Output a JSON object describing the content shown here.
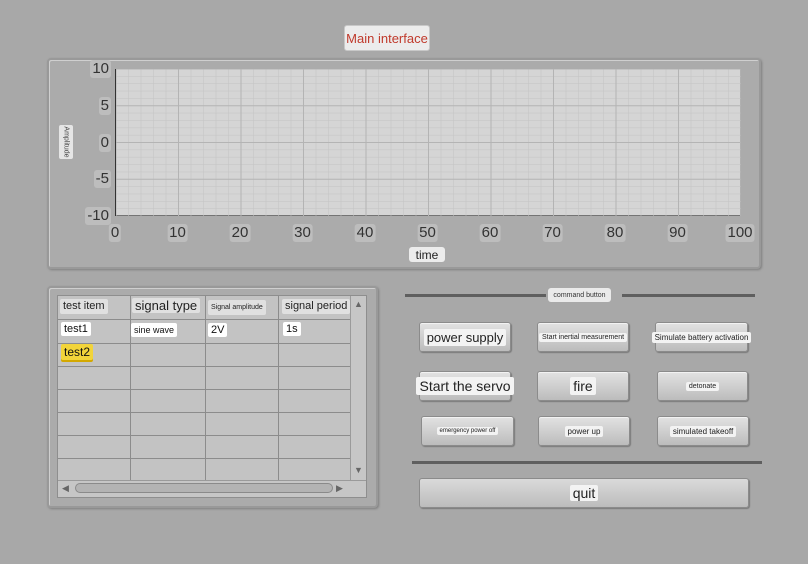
{
  "header": {
    "title": "Main interface"
  },
  "chart_data": {
    "type": "line",
    "title": "",
    "xlabel": "time",
    "ylabel": "Amplitude",
    "xlim": [
      0,
      100
    ],
    "ylim": [
      -10,
      10
    ],
    "x_ticks": [
      "0",
      "10",
      "20",
      "30",
      "40",
      "50",
      "60",
      "70",
      "80",
      "90",
      "100"
    ],
    "y_ticks": [
      "10",
      "5",
      "0",
      "-5",
      "-10"
    ],
    "grid": true,
    "series": []
  },
  "table": {
    "columns": [
      "test item",
      "signal type",
      "Signal amplitude",
      "signal period"
    ],
    "rows": [
      [
        "test1",
        "sine wave",
        "2V",
        "1s"
      ],
      [
        "test2",
        "",
        "",
        ""
      ]
    ],
    "selected_row": "test2"
  },
  "commands": {
    "section_label": "command button",
    "power_supply": "power supply",
    "start_inertial": "Start inertial measurement",
    "simulate_battery": "Simulate battery activation",
    "start_servo": "Start the servo",
    "fire": "fire",
    "detonate": "detonate",
    "emergency_power_off": "emergency power off",
    "power_up": "power up",
    "simulated_takeoff": "simulated takeoff",
    "quit": "quit"
  },
  "colors": {
    "background": "#a8a8a8",
    "title_text": "#c0392b",
    "selection": "#f2d43a"
  },
  "icons": {
    "scroll_up": "triangle-up",
    "scroll_down": "triangle-down",
    "scroll_left": "triangle-left",
    "scroll_right": "triangle-right"
  }
}
